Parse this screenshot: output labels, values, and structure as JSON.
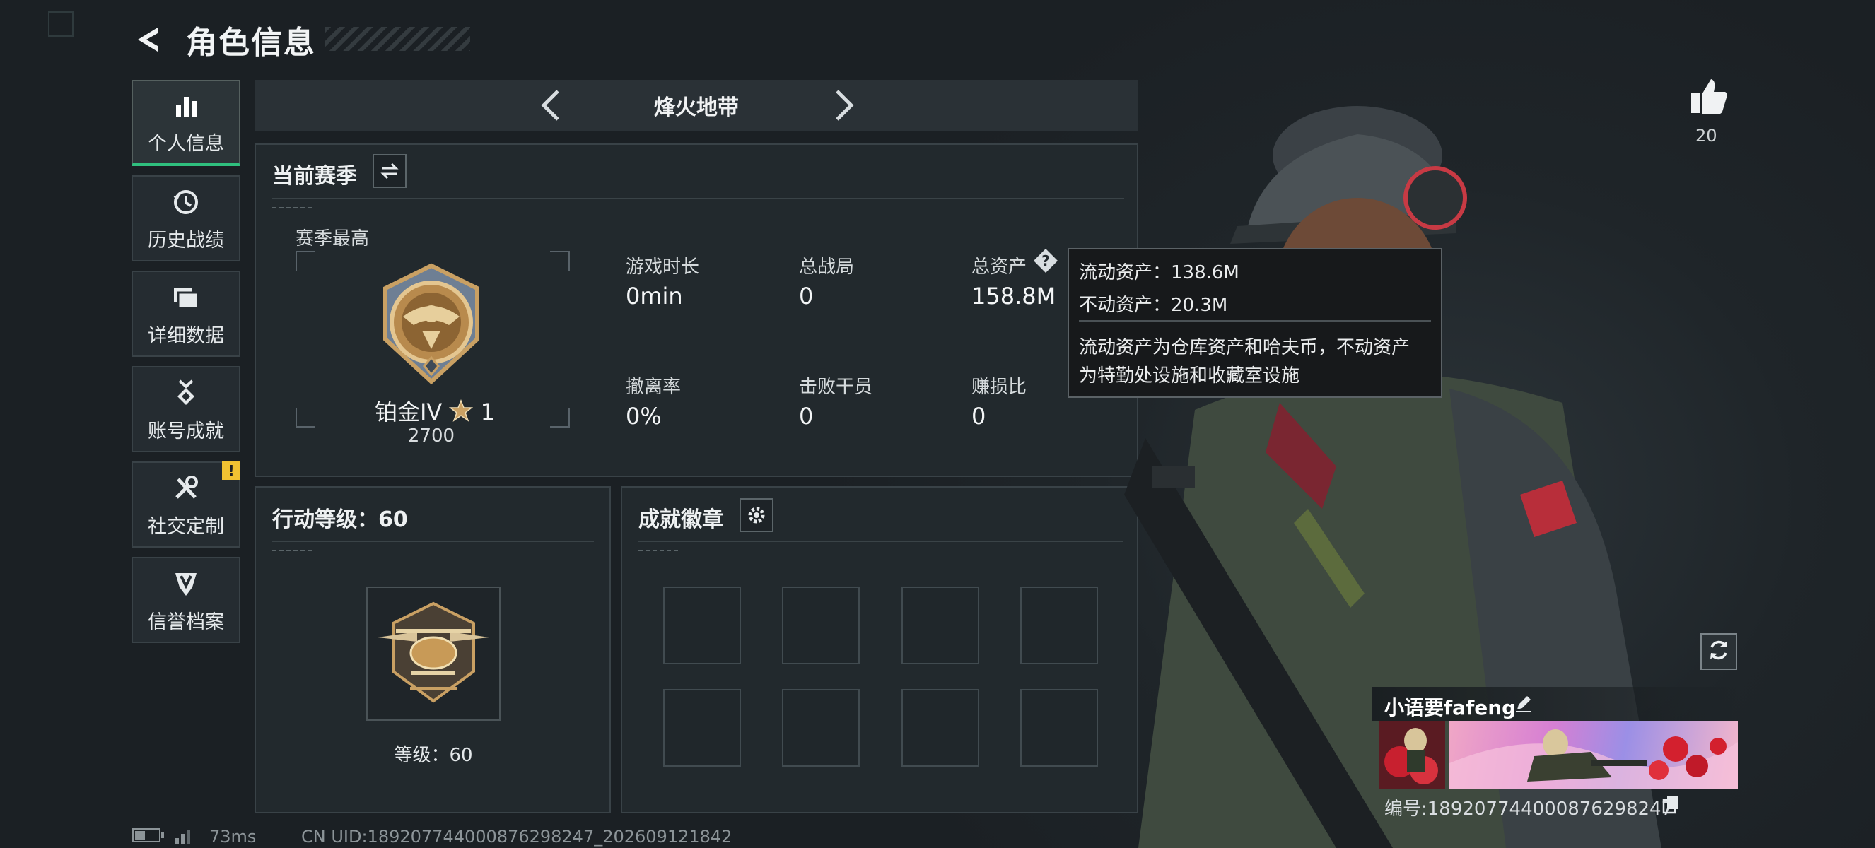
{
  "header": {
    "title": "角色信息"
  },
  "sidebar": {
    "items": [
      {
        "label": "个人信息",
        "icon": "bar-chart-icon",
        "active": true
      },
      {
        "label": "历史战绩",
        "icon": "history-icon"
      },
      {
        "label": "详细数据",
        "icon": "folders-icon"
      },
      {
        "label": "账号成就",
        "icon": "medal-icon"
      },
      {
        "label": "社交定制",
        "icon": "tools-icon",
        "badge": "!"
      },
      {
        "label": "信誉档案",
        "icon": "shield-icon"
      }
    ]
  },
  "mode": {
    "title": "烽火地带"
  },
  "season": {
    "title": "当前赛季",
    "best_label": "赛季最高",
    "rank_name": "铂金IV",
    "rank_stars": "1",
    "rank_score": "2700",
    "stats": [
      {
        "label": "游戏时长",
        "value": "0min"
      },
      {
        "label": "总战局",
        "value": "0"
      },
      {
        "label": "总资产",
        "value": "158.8M"
      },
      {
        "label": "撤离率",
        "value": "0%"
      },
      {
        "label": "击败干员",
        "value": "0"
      },
      {
        "label": "赚损比",
        "value": "0"
      }
    ]
  },
  "tooltip": {
    "liquid": "流动资产：138.6M",
    "fixed": "不动资产：20.3M",
    "desc_line1": "流动资产为仓库资产和哈夫币，不动资产",
    "desc_line2": "为特勤处设施和收藏室设施"
  },
  "level": {
    "title": "行动等级：60",
    "label": "等级：60"
  },
  "achievements": {
    "title": "成就徽章",
    "slots": 8
  },
  "profile": {
    "likes": "20",
    "name": "小语要fafeng",
    "id": "编号:189207744000876298247"
  },
  "footer": {
    "ping": "73ms",
    "uid": "CN UID:189207744000876298247_202609121842"
  },
  "colors": {
    "accent_green": "#2fbf7e",
    "warn_yellow": "#f1c232",
    "gold": "#c9a063"
  }
}
